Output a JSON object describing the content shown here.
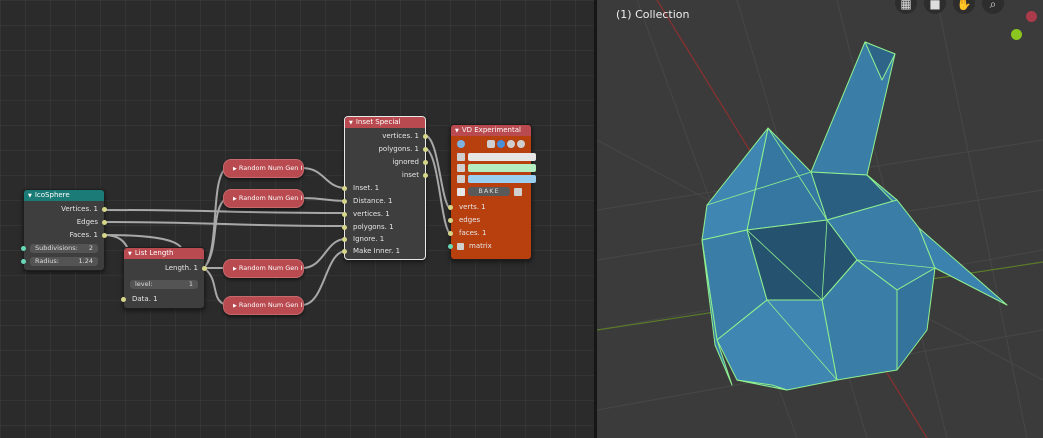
{
  "viewport": {
    "collection_label": "(1) Collection",
    "nav_buttons": [
      "grid-icon",
      "camera-icon",
      "hand-icon",
      "zoom-icon"
    ],
    "gizmo_colors": {
      "x": "#ab3b4a",
      "y": "#8bc51f"
    },
    "mesh_color": "#3a7ea8",
    "wire_color": "#8ff08f"
  },
  "nodes": {
    "icosphere": {
      "title": "IcoSphere",
      "outputs": [
        "Vertices. 1",
        "Edges",
        "Faces. 1"
      ],
      "subdivisions_label": "Subdivisions:",
      "subdivisions_value": "2",
      "radius_label": "Radius:",
      "radius_value": "1.24",
      "header_color": "#1b7b76"
    },
    "list_length": {
      "title": "List Length",
      "output": "Length. 1",
      "level_label": "level:",
      "level_value": "1",
      "input": "Data. 1",
      "header_color": "#b84a50"
    },
    "random_nodes": [
      {
        "label": "Random Num Gen I"
      },
      {
        "label": "Random Num Gen I"
      },
      {
        "label": "Random Num Gen I"
      },
      {
        "label": "Random Num Gen I"
      }
    ],
    "inset_special": {
      "title": "Inset Special",
      "outputs": [
        "vertices. 1",
        "polygons. 1",
        "ignored",
        "inset"
      ],
      "inputs": [
        "Inset. 1",
        "Distance. 1",
        "vertices. 1",
        "polygons. 1",
        "Ignore. 1",
        "Make Inner. 1"
      ],
      "header_color": "#b84a50"
    },
    "vd_experimental": {
      "title": "VD Experimental",
      "bake_label": "BAKE",
      "inputs": [
        "verts. 1",
        "edges",
        "faces. 1",
        "matrix"
      ],
      "colors": {
        "vertex": "#e6e6e6",
        "edge": "#b4eec0",
        "face": "#9acff0",
        "body": "#b8400f"
      }
    }
  }
}
